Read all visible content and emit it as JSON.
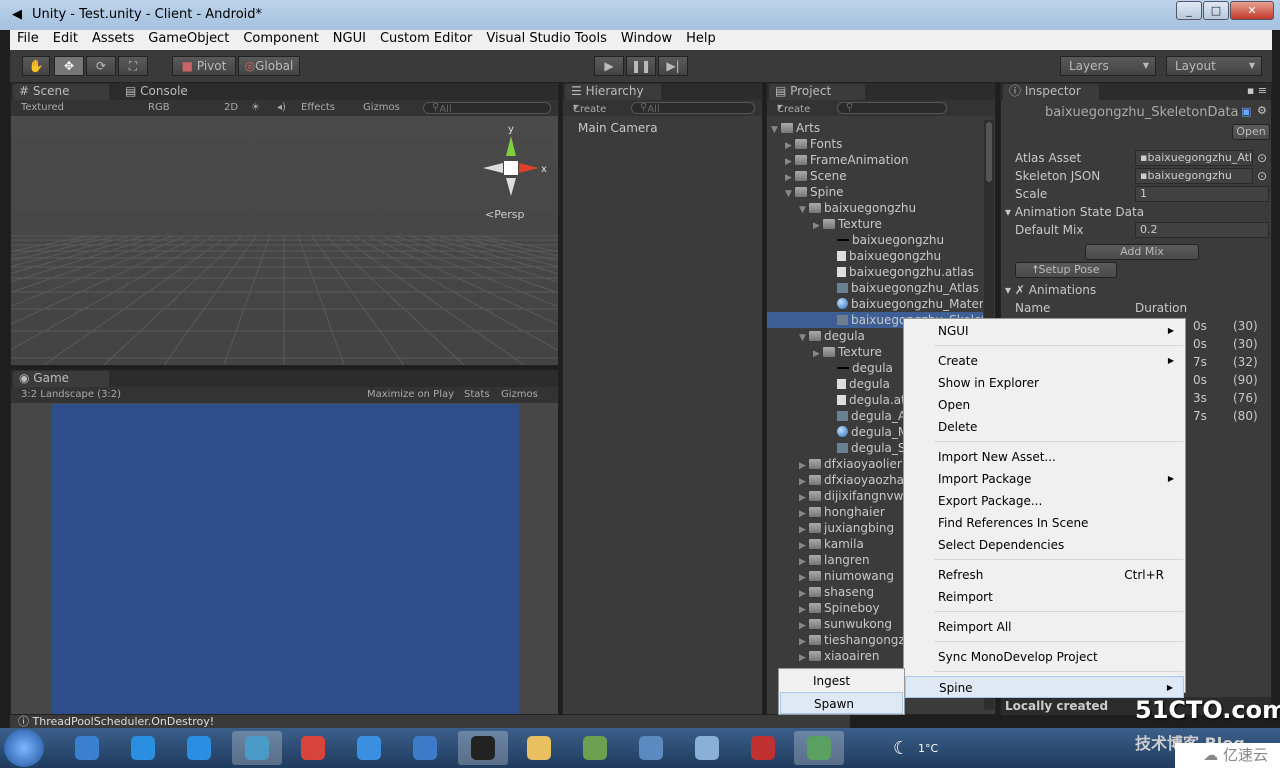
{
  "window": {
    "title": "Unity - Test.unity - Client - Android*"
  },
  "menu": [
    "File",
    "Edit",
    "Assets",
    "GameObject",
    "Component",
    "NGUI",
    "Custom Editor",
    "Visual Studio Tools",
    "Window",
    "Help"
  ],
  "toolbar": {
    "pivot": "Pivot",
    "global": "Global",
    "layers": "Layers",
    "layout": "Layout"
  },
  "scene": {
    "tab": "Scene",
    "console_tab": "Console",
    "shading": "Textured",
    "channel": "RGB",
    "mode_2d": "2D",
    "effects": "Effects",
    "gizmos": "Gizmos",
    "search_placeholder": "All",
    "persp": "Persp",
    "axis_x": "x",
    "axis_y": "y"
  },
  "game": {
    "tab": "Game",
    "aspect": "3:2 Landscape (3:2)",
    "maximize": "Maximize on Play",
    "stats": "Stats",
    "gizmos": "Gizmos",
    "bg_color": "#2f4f8c"
  },
  "hierarchy": {
    "tab": "Hierarchy",
    "create": "Create",
    "search_placeholder": "All",
    "items": [
      "Main Camera"
    ]
  },
  "project": {
    "tab": "Project",
    "create": "Create",
    "items": [
      {
        "label": "Arts",
        "level": 0,
        "icon": "folder",
        "open": true
      },
      {
        "label": "Fonts",
        "level": 1,
        "icon": "folder"
      },
      {
        "label": "FrameAnimation",
        "level": 1,
        "icon": "folder"
      },
      {
        "label": "Scene",
        "level": 1,
        "icon": "folder"
      },
      {
        "label": "Spine",
        "level": 1,
        "icon": "folder",
        "open": true
      },
      {
        "label": "baixuegongzhu",
        "level": 2,
        "icon": "folder",
        "open": true
      },
      {
        "label": "Texture",
        "level": 3,
        "icon": "folder"
      },
      {
        "label": "baixuegongzhu",
        "level": 4,
        "icon": "line"
      },
      {
        "label": "baixuegongzhu",
        "level": 4,
        "icon": "file"
      },
      {
        "label": "baixuegongzhu.atlas",
        "level": 4,
        "icon": "file"
      },
      {
        "label": "baixuegongzhu_Atlas",
        "level": 4,
        "icon": "asset"
      },
      {
        "label": "baixuegongzhu_Material",
        "level": 4,
        "icon": "sphere"
      },
      {
        "label": "baixuegongzhu_Skelet",
        "level": 4,
        "icon": "asset",
        "selected": true
      },
      {
        "label": "degula",
        "level": 2,
        "icon": "folder",
        "open": true
      },
      {
        "label": "Texture",
        "level": 3,
        "icon": "folder"
      },
      {
        "label": "degula",
        "level": 4,
        "icon": "line"
      },
      {
        "label": "degula",
        "level": 4,
        "icon": "file"
      },
      {
        "label": "degula.atla",
        "level": 4,
        "icon": "file"
      },
      {
        "label": "degula_Atla",
        "level": 4,
        "icon": "asset"
      },
      {
        "label": "degula_Ma",
        "level": 4,
        "icon": "sphere"
      },
      {
        "label": "degula_Sk",
        "level": 4,
        "icon": "asset"
      },
      {
        "label": "dfxiaoyaolier",
        "level": 2,
        "icon": "folder"
      },
      {
        "label": "dfxiaoyaozha",
        "level": 2,
        "icon": "folder"
      },
      {
        "label": "dijixifangnvw",
        "level": 2,
        "icon": "folder"
      },
      {
        "label": "honghaier",
        "level": 2,
        "icon": "folder"
      },
      {
        "label": "juxiangbing",
        "level": 2,
        "icon": "folder"
      },
      {
        "label": "kamila",
        "level": 2,
        "icon": "folder"
      },
      {
        "label": "langren",
        "level": 2,
        "icon": "folder"
      },
      {
        "label": "niumowang",
        "level": 2,
        "icon": "folder"
      },
      {
        "label": "shaseng",
        "level": 2,
        "icon": "folder"
      },
      {
        "label": "Spineboy",
        "level": 2,
        "icon": "folder"
      },
      {
        "label": "sunwukong",
        "level": 2,
        "icon": "folder"
      },
      {
        "label": "tieshangongz",
        "level": 2,
        "icon": "folder"
      },
      {
        "label": "xiaoairen",
        "level": 2,
        "icon": "folder"
      }
    ]
  },
  "inspector": {
    "tab": "Inspector",
    "title": "baixuegongzhu_SkeletonData",
    "open": "Open",
    "atlas_label": "Atlas Asset",
    "atlas_value": "baixuegongzhu_Atlas",
    "json_label": "Skeleton JSON",
    "json_value": "baixuegongzhu",
    "scale_label": "Scale",
    "scale_value": "1",
    "state_header": "Animation State Data",
    "mix_label": "Default Mix",
    "mix_value": "0.2",
    "add_mix": "Add Mix",
    "setup_pose": "Setup Pose",
    "animations_header": "Animations",
    "col_name": "Name",
    "col_duration": "Duration",
    "animations": [
      {
        "duration": "0s",
        "frames": "(30)"
      },
      {
        "duration": "0s",
        "frames": "(30)"
      },
      {
        "duration": "7s",
        "frames": "(32)"
      },
      {
        "duration": "0s",
        "frames": "(90)"
      },
      {
        "duration": "3s",
        "frames": "(76)"
      },
      {
        "duration": "7s",
        "frames": "(80)"
      }
    ],
    "footer": "Locally created"
  },
  "context_menu": [
    {
      "label": "NGUI",
      "submenu": true
    },
    {
      "sep": true
    },
    {
      "label": "Create",
      "submenu": true
    },
    {
      "label": "Show in Explorer"
    },
    {
      "label": "Open"
    },
    {
      "label": "Delete"
    },
    {
      "sep": true
    },
    {
      "label": "Import New Asset..."
    },
    {
      "label": "Import Package",
      "submenu": true
    },
    {
      "label": "Export Package..."
    },
    {
      "label": "Find References In Scene"
    },
    {
      "label": "Select Dependencies"
    },
    {
      "sep": true
    },
    {
      "label": "Refresh",
      "shortcut": "Ctrl+R"
    },
    {
      "label": "Reimport"
    },
    {
      "sep": true
    },
    {
      "label": "Reimport All"
    },
    {
      "sep": true
    },
    {
      "label": "Sync MonoDevelop Project"
    },
    {
      "sep": true
    },
    {
      "label": "Spine",
      "submenu": true,
      "highlighted": true
    }
  ],
  "spine_submenu": [
    "Ingest",
    "Spawn"
  ],
  "status": {
    "message": "ThreadPoolScheduler.OnDestroy!"
  },
  "taskbar": {
    "temperature": "1°C",
    "watermark": "51CTO.com",
    "watermark_sub": "技术博客 Blog",
    "brand": "亿速云"
  }
}
